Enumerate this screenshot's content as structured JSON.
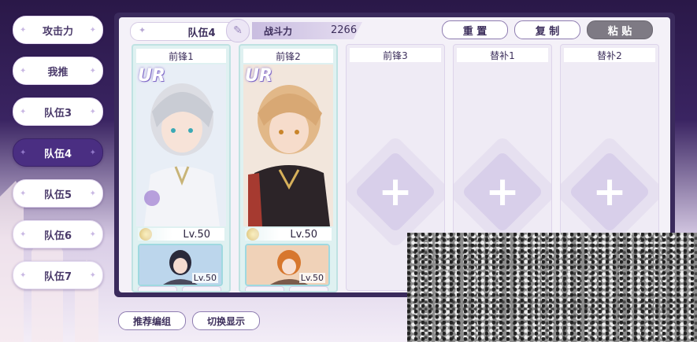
{
  "sidebar": {
    "items": [
      {
        "label": "攻击力"
      },
      {
        "label": "我推"
      },
      {
        "label": "队伍3"
      },
      {
        "label": "队伍4"
      },
      {
        "label": "队伍5"
      },
      {
        "label": "队伍6"
      },
      {
        "label": "队伍7"
      }
    ],
    "active_index": 3
  },
  "header": {
    "team_name": "队伍4",
    "power_label": "战斗力",
    "power_value": "2266",
    "buttons": {
      "reset": "重 置",
      "copy": "复 制",
      "paste": "粘 贴"
    }
  },
  "slots": [
    {
      "label": "前锋1",
      "rarity": "UR",
      "level": "Lv.50",
      "support_level": "Lv.50",
      "filled": true
    },
    {
      "label": "前锋2",
      "rarity": "UR",
      "level": "Lv.50",
      "support_level": "Lv.50",
      "filled": true
    },
    {
      "label": "前锋3",
      "filled": false
    },
    {
      "label": "替补1",
      "filled": false
    },
    {
      "label": "替补2",
      "filled": false
    }
  ],
  "footer": {
    "recommend": "推荐编组",
    "toggle": "切换显示"
  },
  "colors": {
    "panel": "#3a2a5c",
    "active_tab": "#4a2e82",
    "slot_filled_border": "#bfe2e2",
    "add_diamond": "#d8cfea"
  },
  "icons": {
    "edit": "feather-icon",
    "gear_left": "fist-icon",
    "gear_right": "lock-icon",
    "add": "plus-icon"
  }
}
